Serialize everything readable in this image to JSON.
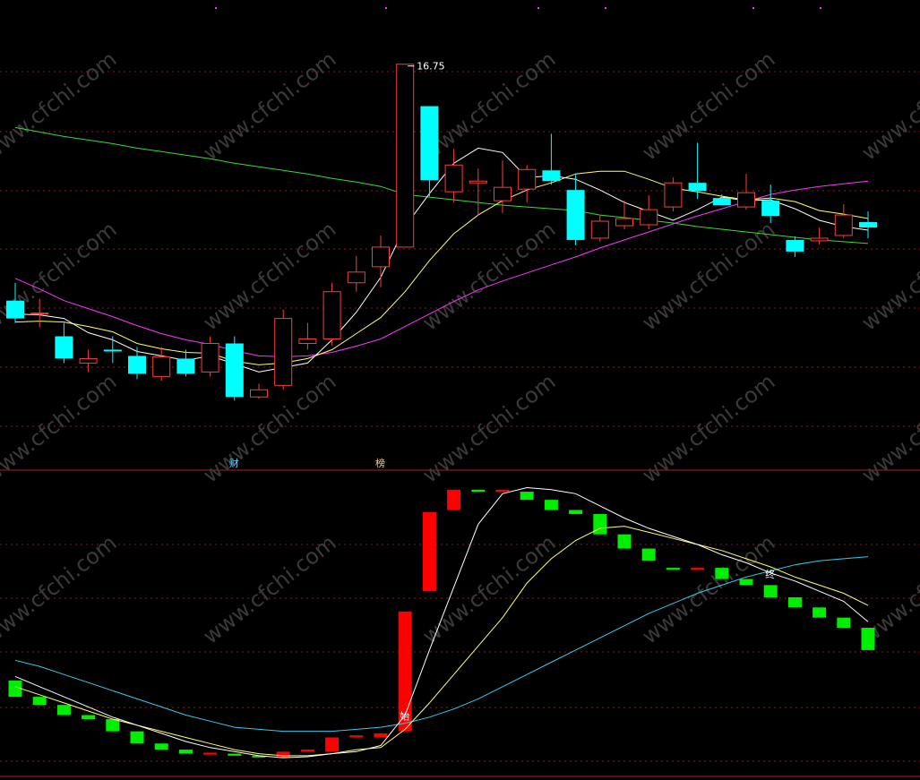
{
  "colors": {
    "background": "#000000",
    "grid": "#8a1b1b",
    "divider": "#b32020",
    "up": "#ff3b3b",
    "down": "#00ffff",
    "ma_short": "#ffffff",
    "ma_mid": "#ffff66",
    "ma_long": "#ff33ff",
    "ma_vlong": "#33dd33",
    "osc_up": "#ff0000",
    "osc_down": "#00ee00",
    "osc_line_white": "#ffffff",
    "osc_line_yellow": "#ffff66",
    "osc_line_cyan": "#33ccee",
    "watermark": "#3a3a3a",
    "mark_cai": "#66ccff",
    "mark_bang": "#ffcc88"
  },
  "watermark": "www.cfchi.com",
  "chart_data": [
    {
      "type": "candlestick",
      "title": "",
      "peak_label": "16.75",
      "candles": [
        {
          "o": 14.1,
          "h": 14.3,
          "l": 13.85,
          "c": 13.9
        },
        {
          "o": 13.96,
          "h": 14.12,
          "l": 13.8,
          "c": 13.96
        },
        {
          "o": 13.7,
          "h": 13.85,
          "l": 13.4,
          "c": 13.45
        },
        {
          "o": 13.4,
          "h": 13.55,
          "l": 13.3,
          "c": 13.45
        },
        {
          "o": 13.55,
          "h": 13.7,
          "l": 13.4,
          "c": 13.53
        },
        {
          "o": 13.48,
          "h": 13.58,
          "l": 13.22,
          "c": 13.28
        },
        {
          "o": 13.25,
          "h": 13.58,
          "l": 13.2,
          "c": 13.47
        },
        {
          "o": 13.45,
          "h": 13.55,
          "l": 13.25,
          "c": 13.28
        },
        {
          "o": 13.3,
          "h": 13.7,
          "l": 13.25,
          "c": 13.62
        },
        {
          "o": 13.62,
          "h": 13.7,
          "l": 12.98,
          "c": 13.02
        },
        {
          "o": 13.02,
          "h": 13.17,
          "l": 13.0,
          "c": 13.1
        },
        {
          "o": 13.15,
          "h": 14.0,
          "l": 13.1,
          "c": 13.9
        },
        {
          "o": 13.62,
          "h": 13.85,
          "l": 13.55,
          "c": 13.67
        },
        {
          "o": 13.67,
          "h": 14.3,
          "l": 13.6,
          "c": 14.2
        },
        {
          "o": 14.3,
          "h": 14.6,
          "l": 14.2,
          "c": 14.42
        },
        {
          "o": 14.48,
          "h": 14.83,
          "l": 14.25,
          "c": 14.7
        },
        {
          "o": 14.7,
          "h": 16.75,
          "l": 14.7,
          "c": 16.75
        },
        {
          "o": 16.28,
          "h": 16.28,
          "l": 15.27,
          "c": 15.45
        },
        {
          "o": 15.32,
          "h": 15.8,
          "l": 15.2,
          "c": 15.62
        },
        {
          "o": 15.42,
          "h": 15.58,
          "l": 15.05,
          "c": 15.44
        },
        {
          "o": 15.22,
          "h": 15.67,
          "l": 15.08,
          "c": 15.37
        },
        {
          "o": 15.35,
          "h": 15.62,
          "l": 15.2,
          "c": 15.57
        },
        {
          "o": 15.56,
          "h": 15.97,
          "l": 15.4,
          "c": 15.44
        },
        {
          "o": 15.34,
          "h": 15.52,
          "l": 14.72,
          "c": 14.78
        },
        {
          "o": 14.8,
          "h": 15.06,
          "l": 14.76,
          "c": 14.99
        },
        {
          "o": 14.94,
          "h": 15.22,
          "l": 14.9,
          "c": 15.02
        },
        {
          "o": 14.95,
          "h": 15.28,
          "l": 14.9,
          "c": 15.12
        },
        {
          "o": 15.15,
          "h": 15.48,
          "l": 15.1,
          "c": 15.42
        },
        {
          "o": 15.42,
          "h": 15.87,
          "l": 15.24,
          "c": 15.33
        },
        {
          "o": 15.25,
          "h": 15.29,
          "l": 15.17,
          "c": 15.17
        },
        {
          "o": 15.15,
          "h": 15.52,
          "l": 15.12,
          "c": 15.31
        },
        {
          "o": 15.22,
          "h": 15.4,
          "l": 14.97,
          "c": 15.05
        },
        {
          "o": 14.78,
          "h": 14.82,
          "l": 14.59,
          "c": 14.65
        },
        {
          "o": 14.77,
          "h": 14.92,
          "l": 14.73,
          "c": 14.8
        },
        {
          "o": 14.83,
          "h": 15.18,
          "l": 14.8,
          "c": 15.06
        },
        {
          "o": 14.98,
          "h": 15.1,
          "l": 14.8,
          "c": 14.92
        }
      ],
      "ma_short": [
        13.95,
        13.94,
        13.9,
        13.74,
        13.66,
        13.53,
        13.48,
        13.43,
        13.48,
        13.39,
        13.3,
        13.35,
        13.4,
        13.66,
        13.97,
        14.36,
        14.93,
        15.3,
        15.64,
        15.81,
        15.76,
        15.48,
        15.5,
        15.46,
        15.34,
        15.2,
        15.1,
        15.0,
        15.12,
        15.26,
        15.22,
        15.23,
        15.13,
        15.0,
        14.93,
        14.89
      ],
      "ma_mid": [
        13.86,
        13.87,
        13.86,
        13.81,
        13.75,
        13.62,
        13.56,
        13.52,
        13.51,
        13.42,
        13.38,
        13.4,
        13.45,
        13.55,
        13.73,
        13.91,
        14.2,
        14.55,
        14.85,
        15.06,
        15.22,
        15.34,
        15.42,
        15.52,
        15.55,
        15.55,
        15.46,
        15.36,
        15.32,
        15.27,
        15.23,
        15.25,
        15.21,
        15.11,
        15.07,
        15.02
      ],
      "ma_long": [
        14.35,
        14.23,
        14.1,
        14.01,
        13.92,
        13.82,
        13.73,
        13.66,
        13.61,
        13.54,
        13.48,
        13.47,
        13.48,
        13.52,
        13.59,
        13.67,
        13.81,
        13.95,
        14.09,
        14.22,
        14.32,
        14.41,
        14.5,
        14.59,
        14.69,
        14.78,
        14.87,
        14.96,
        15.05,
        15.13,
        15.21,
        15.29,
        15.34,
        15.38,
        15.41,
        15.44
      ],
      "ma_vlong": [
        16.04,
        15.99,
        15.94,
        15.9,
        15.86,
        15.81,
        15.77,
        15.73,
        15.69,
        15.64,
        15.6,
        15.56,
        15.52,
        15.47,
        15.43,
        15.38,
        15.29,
        15.26,
        15.23,
        15.2,
        15.17,
        15.15,
        15.13,
        15.11,
        15.06,
        15.03,
        15.0,
        14.97,
        14.93,
        14.9,
        14.87,
        14.84,
        14.81,
        14.78,
        14.76,
        14.74
      ],
      "ylim": [
        12.35,
        17.47
      ]
    },
    {
      "type": "bar",
      "title": "",
      "bars": [
        {
          "top": -0.63,
          "bottom": -0.55,
          "dir": "down"
        },
        {
          "top": -0.67,
          "bottom": -0.63,
          "dir": "down"
        },
        {
          "top": -0.72,
          "bottom": -0.67,
          "dir": "down"
        },
        {
          "top": -0.74,
          "bottom": -0.72,
          "dir": "down"
        },
        {
          "top": -0.8,
          "bottom": -0.74,
          "dir": "down"
        },
        {
          "top": -0.86,
          "bottom": -0.8,
          "dir": "down"
        },
        {
          "top": -0.89,
          "bottom": -0.86,
          "dir": "down"
        },
        {
          "top": -0.91,
          "bottom": -0.89,
          "dir": "down"
        },
        {
          "top": -0.915,
          "bottom": -0.905,
          "dir": "up"
        },
        {
          "top": -0.92,
          "bottom": -0.91,
          "dir": "down"
        },
        {
          "top": -0.925,
          "bottom": -0.92,
          "dir": "down"
        },
        {
          "top": -0.9,
          "bottom": -0.93,
          "dir": "up"
        },
        {
          "top": -0.89,
          "bottom": -0.9,
          "dir": "up"
        },
        {
          "top": -0.83,
          "bottom": -0.9,
          "dir": "up"
        },
        {
          "top": -0.83,
          "bottom": -0.82,
          "dir": "up"
        },
        {
          "top": -0.81,
          "bottom": -0.83,
          "dir": "up"
        },
        {
          "top": -0.21,
          "bottom": -0.8,
          "dir": "up"
        },
        {
          "top": 0.28,
          "bottom": -0.11,
          "dir": "up"
        },
        {
          "top": 0.39,
          "bottom": 0.29,
          "dir": "up"
        },
        {
          "top": 0.39,
          "bottom": 0.38,
          "dir": "down"
        },
        {
          "top": 0.39,
          "bottom": 0.38,
          "dir": "up"
        },
        {
          "top": 0.38,
          "bottom": 0.34,
          "dir": "down"
        },
        {
          "top": 0.34,
          "bottom": 0.29,
          "dir": "down"
        },
        {
          "top": 0.29,
          "bottom": 0.27,
          "dir": "down"
        },
        {
          "top": 0.27,
          "bottom": 0.17,
          "dir": "down"
        },
        {
          "top": 0.17,
          "bottom": 0.1,
          "dir": "down"
        },
        {
          "top": 0.1,
          "bottom": 0.04,
          "dir": "down"
        },
        {
          "top": 0.005,
          "bottom": -0.005,
          "dir": "down"
        },
        {
          "top": 0.005,
          "bottom": -0.005,
          "dir": "up"
        },
        {
          "top": 0.005,
          "bottom": -0.05,
          "dir": "down"
        },
        {
          "top": -0.05,
          "bottom": -0.08,
          "dir": "down"
        },
        {
          "top": -0.08,
          "bottom": -0.14,
          "dir": "down"
        },
        {
          "top": -0.14,
          "bottom": -0.19,
          "dir": "down"
        },
        {
          "top": -0.19,
          "bottom": -0.24,
          "dir": "down"
        },
        {
          "top": -0.24,
          "bottom": -0.29,
          "dir": "down"
        },
        {
          "top": -0.29,
          "bottom": -0.4,
          "dir": "down"
        }
      ],
      "line_white": [
        -0.53,
        -0.58,
        -0.63,
        -0.68,
        -0.73,
        -0.77,
        -0.81,
        -0.85,
        -0.88,
        -0.9,
        -0.92,
        -0.93,
        -0.925,
        -0.91,
        -0.9,
        -0.87,
        -0.72,
        -0.4,
        -0.09,
        0.22,
        0.37,
        0.4,
        0.39,
        0.37,
        0.31,
        0.25,
        0.2,
        0.16,
        0.12,
        0.07,
        0.03,
        -0.02,
        -0.06,
        -0.11,
        -0.16,
        -0.26
      ],
      "line_yellow": [
        -0.58,
        -0.62,
        -0.66,
        -0.7,
        -0.74,
        -0.77,
        -0.8,
        -0.83,
        -0.86,
        -0.89,
        -0.91,
        -0.92,
        -0.92,
        -0.91,
        -0.89,
        -0.88,
        -0.79,
        -0.66,
        -0.52,
        -0.38,
        -0.24,
        -0.07,
        0.05,
        0.14,
        0.2,
        0.21,
        0.18,
        0.15,
        0.12,
        0.09,
        0.05,
        0.01,
        -0.04,
        -0.08,
        -0.12,
        -0.18
      ],
      "line_cyan": [
        -0.45,
        -0.48,
        -0.52,
        -0.56,
        -0.6,
        -0.64,
        -0.68,
        -0.72,
        -0.75,
        -0.78,
        -0.79,
        -0.8,
        -0.8,
        -0.8,
        -0.79,
        -0.78,
        -0.76,
        -0.73,
        -0.69,
        -0.64,
        -0.58,
        -0.52,
        -0.46,
        -0.4,
        -0.34,
        -0.28,
        -0.22,
        -0.17,
        -0.12,
        -0.08,
        -0.04,
        -0.01,
        0.02,
        0.04,
        0.05,
        0.06
      ],
      "marks": [
        {
          "index": 16,
          "text": "始",
          "value": -0.72
        },
        {
          "index": 31,
          "text": "终",
          "value": -0.02
        }
      ],
      "ylim": [
        -1.0,
        0.42
      ]
    }
  ],
  "events": [
    {
      "index": 9,
      "text": "财"
    },
    {
      "index": 15,
      "text": "榜"
    }
  ]
}
